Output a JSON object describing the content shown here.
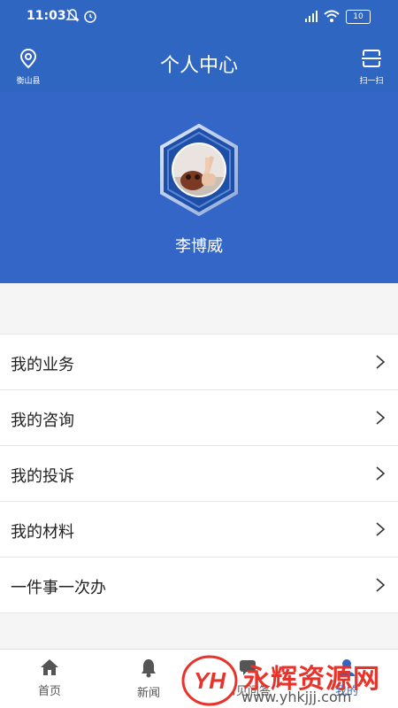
{
  "status": {
    "time": "11:03",
    "battery": "10"
  },
  "header": {
    "location_label": "衡山县",
    "title": "个人中心",
    "scan_label": "扫一扫"
  },
  "profile": {
    "name": "李博威"
  },
  "menu": {
    "items": [
      {
        "label": "我的业务"
      },
      {
        "label": "我的咨询"
      },
      {
        "label": "我的投诉"
      },
      {
        "label": "我的材料"
      },
      {
        "label": "一件事一次办"
      }
    ]
  },
  "tabs": [
    {
      "label": "首页",
      "icon": "home-icon"
    },
    {
      "label": "新闻",
      "icon": "bell-icon"
    },
    {
      "label": "常见问答",
      "icon": "faq-icon"
    },
    {
      "label": "我的",
      "icon": "user-icon"
    }
  ],
  "watermark": {
    "brand": "永辉资源网",
    "url": "www.yhkjjj.com",
    "logo": "YH"
  },
  "colors": {
    "primary": "#2f66c2",
    "profile_bg": "#3366c6",
    "watermark_red": "#e8322a"
  }
}
